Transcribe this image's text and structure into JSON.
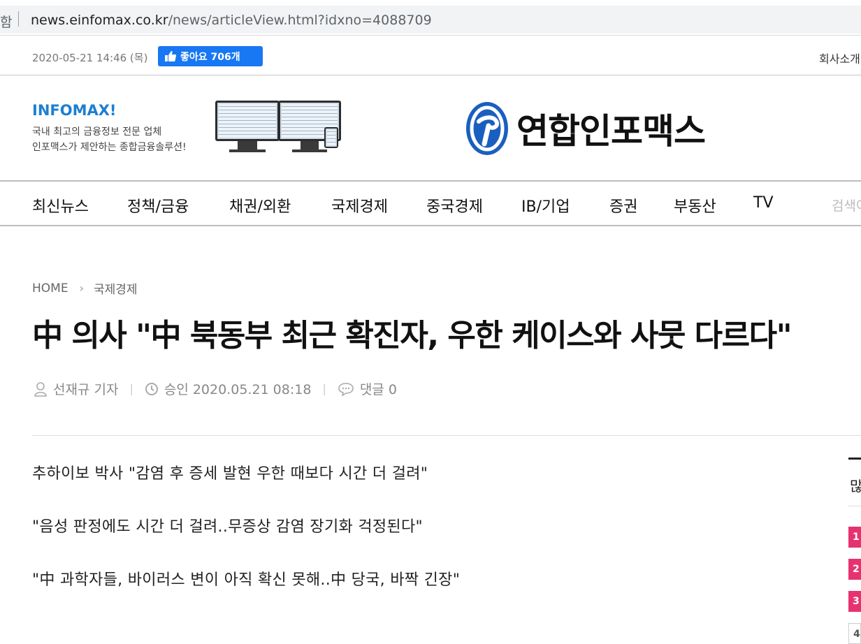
{
  "browser": {
    "url_prefix": "함",
    "url_host": "news.einfomax.co.kr",
    "url_path": "/news/articleView.html?idxno=4088709"
  },
  "topbar": {
    "date": "2020-05-21 14:46 (목)",
    "like_label": "좋아요 706개",
    "company_link": "회사소개"
  },
  "header": {
    "ad_title": "INFOMAX!",
    "ad_line1": "국내 최고의 금융정보 전문 업체",
    "ad_line2": "인포맥스가 제안하는 종합금융솔루션!",
    "logo_text": "연합인포맥스",
    "logo_color": "#1a5fbf"
  },
  "nav": {
    "items": [
      "최신뉴스",
      "정책/금융",
      "채권/외환",
      "국제경제",
      "중국경제",
      "IB/기업",
      "증권",
      "부동산",
      "TV"
    ],
    "search_label": "검색어"
  },
  "breadcrumb": {
    "home": "HOME",
    "section": "국제경제"
  },
  "article": {
    "headline": "中 의사 \"中 북동부 최근 확진자, 우한 케이스와 사뭇 다르다\"",
    "author": "선재규 기자",
    "approved": "승인 2020.05.21 08:18",
    "comments": "댓글 0",
    "subtitles": [
      "추하이보 박사 \"감염 후 증세 발현 우한 때보다 시간 더 걸려\"",
      "\"음성 판정에도 시간 더 걸려..무증상 감염 장기화 걱정된다\"",
      "\"中 과학자들, 바이러스 변이 아직 확신 못해..中 당국, 바짝 긴장\""
    ]
  },
  "sidebar": {
    "title": "많이 본 뉴스",
    "ranks": [
      "1",
      "2",
      "3",
      "4"
    ],
    "rank_color": "#e6336f"
  }
}
